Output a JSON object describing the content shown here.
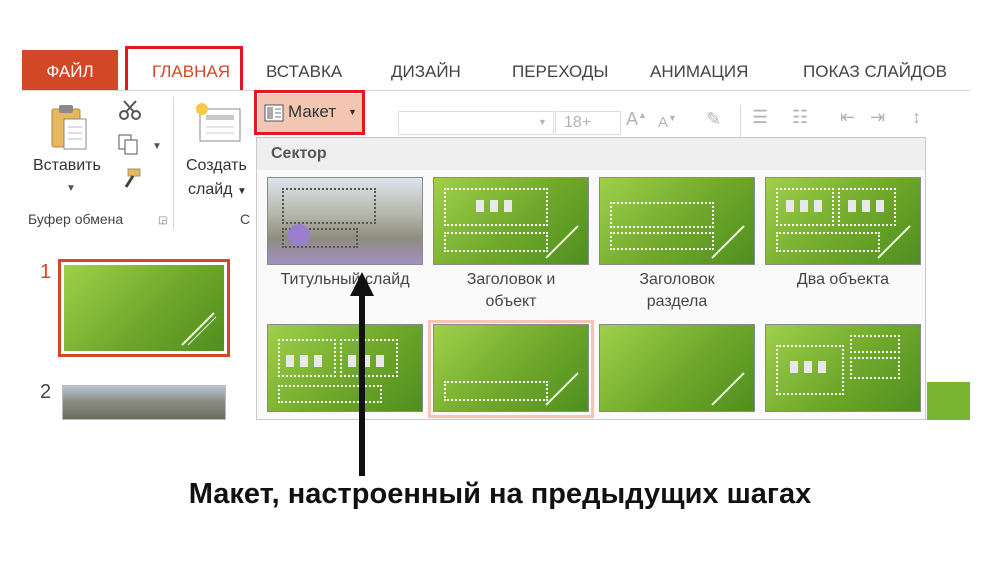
{
  "tabs": [
    {
      "label": "ФАЙЛ"
    },
    {
      "label": "ГЛАВНАЯ"
    },
    {
      "label": "ВСТАВКА"
    },
    {
      "label": "ДИЗАЙН"
    },
    {
      "label": "ПЕРЕХОДЫ"
    },
    {
      "label": "АНИМАЦИЯ"
    },
    {
      "label": "ПОКАЗ СЛАЙДОВ"
    }
  ],
  "clipboard": {
    "paste_label": "Вставить",
    "group_label": "Буфер обмена"
  },
  "slides": {
    "new_slide_line1": "Создать",
    "new_slide_line2": "слайд",
    "layout_button": "Макет",
    "section_letter": "С"
  },
  "font": {
    "size": "18+"
  },
  "gallery": {
    "theme_name": "Сектор",
    "layouts": [
      {
        "caption_line1": "Титульный слайд",
        "caption_line2": ""
      },
      {
        "caption_line1": "Заголовок и",
        "caption_line2": "объект"
      },
      {
        "caption_line1": "Заголовок",
        "caption_line2": "раздела"
      },
      {
        "caption_line1": "Два объекта",
        "caption_line2": ""
      }
    ]
  },
  "slide_panel": {
    "numbers": [
      "1",
      "2"
    ]
  },
  "annotation": {
    "caption": "Макет, настроенный на предыдущих шагах"
  },
  "colors": {
    "file_tab": "#d24726",
    "highlight": "#e5161d",
    "slide_green": "#7ab532"
  }
}
